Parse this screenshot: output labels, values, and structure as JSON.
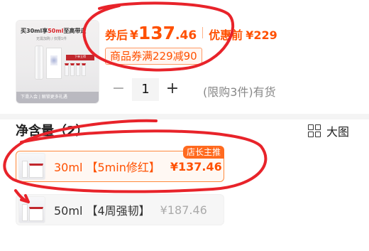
{
  "product": {
    "thumbnail": {
      "banner_prefix": "买30ml享",
      "banner_highlight": "50ml",
      "banner_suffix": "至高带走",
      "sub_text": "无需加购 / 仅限1件",
      "tag_text": "下单立得",
      "bottom_text": "下滑入会 | 解锁更多礼遇"
    },
    "price": {
      "coupon_label": "券后",
      "currency": "¥",
      "amount_int": "137",
      "amount_dec": ".46",
      "original_label": "优惠前",
      "original_price": "¥229"
    },
    "voucher": "商品券满229减90",
    "quantity": {
      "minus": "−",
      "value": "1",
      "plus": "+"
    },
    "limit_text": "(限购3件)有货"
  },
  "spec": {
    "title": "净含量（2）",
    "view_toggle": "大图",
    "options": [
      {
        "label": "30ml 【5min修红】",
        "price": "¥137.46",
        "badge": "店长主推",
        "selected": true
      },
      {
        "label": "50ml 【4周强韧】",
        "price": "¥187.46",
        "selected": false
      }
    ]
  },
  "colors": {
    "accent": "#ff5000",
    "annotation": "#e8232a"
  },
  "icons": {
    "view_toggle": "grid-icon"
  }
}
